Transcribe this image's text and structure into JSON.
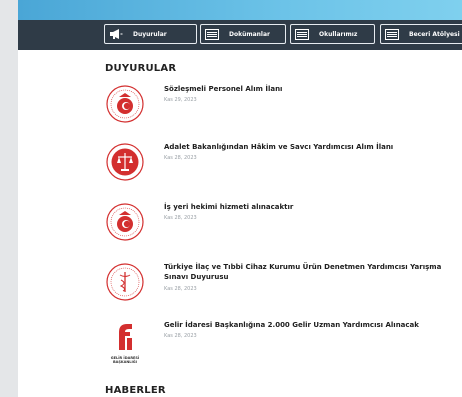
{
  "nav": {
    "items": [
      {
        "label": "Duyurular",
        "icon": "megaphone-icon"
      },
      {
        "label": "Dokümanlar",
        "icon": "document-list-icon"
      },
      {
        "label": "Okullarımız",
        "icon": "document-list-icon"
      },
      {
        "label": "Beceri Atölyesi",
        "icon": "document-list-icon"
      }
    ]
  },
  "announcements": {
    "heading": "DUYURULAR",
    "items": [
      {
        "title": "Sözleşmeli Personel Alım İlanı",
        "date": "Kas 29, 2023",
        "logo": "ministry-seal"
      },
      {
        "title": "Adalet Bakanlığından Hâkim ve Savcı Yardımcısı Alım İlanı",
        "date": "Kas 28, 2023",
        "logo": "justice-seal"
      },
      {
        "title": "İş yeri hekimi hizmeti alınacaktır",
        "date": "Kas 28, 2023",
        "logo": "ministry-seal"
      },
      {
        "title": "Türkiye İlaç ve Tıbbi Cihaz Kurumu Ürün Denetmen Yardımcısı Yarışma Sınavı Duyurusu",
        "date": "Kas 28, 2023",
        "logo": "health-seal"
      },
      {
        "title": "Gelir İdaresi Başkanlığına 2.000 Gelir Uzman Yardımcısı Alınacak",
        "date": "Kas 28, 2023",
        "logo": "gib-logo",
        "logo_text": "GELİR İDARESİ BAŞKANLIĞI"
      }
    ]
  },
  "news": {
    "heading": "HABERLER"
  },
  "colors": {
    "navbar": "#2f3b47",
    "stripe": "#5bb5e0",
    "seal_red": "#d32f2f",
    "date_gray": "#9aa0a6"
  }
}
